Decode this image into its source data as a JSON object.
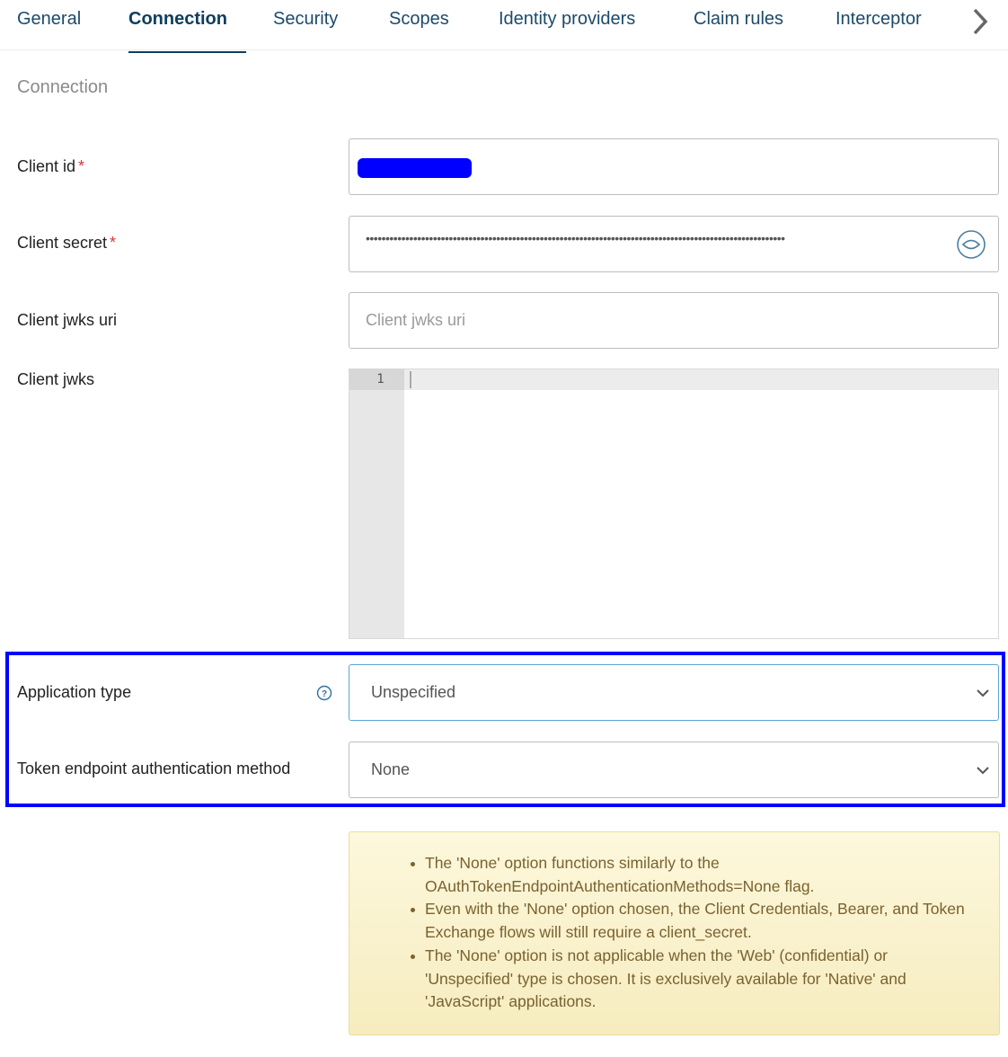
{
  "tabs": [
    {
      "label": "General",
      "active": false
    },
    {
      "label": "Connection",
      "active": true
    },
    {
      "label": "Security",
      "active": false
    },
    {
      "label": "Scopes",
      "active": false
    },
    {
      "label": "Identity providers",
      "active": false
    },
    {
      "label": "Claim rules",
      "active": false
    },
    {
      "label": "Interceptor",
      "active": false
    }
  ],
  "section_title": "Connection",
  "fields": {
    "client_id": {
      "label": "Client id",
      "required_mark": "*",
      "value": "[redacted]"
    },
    "client_secret": {
      "label": "Client secret",
      "required_mark": "*",
      "value": "••••••••••••••••••••••••••••••••••••••••••••••••••••••••••••••••••••••••••••••••••••••••••••••••••••••••••"
    },
    "client_jwks_uri": {
      "label": "Client jwks uri",
      "placeholder": "Client jwks uri",
      "value": ""
    },
    "client_jwks": {
      "label": "Client jwks",
      "line_number": "1",
      "value": ""
    },
    "application_type": {
      "label": "Application type",
      "value": "Unspecified"
    },
    "token_endpoint_auth_method": {
      "label": "Token endpoint authentication method",
      "value": "None"
    }
  },
  "alert": {
    "items": [
      "The 'None' option functions similarly to the OAuthTokenEndpointAuthenticationMethods=None flag.",
      "Even with the 'None' option chosen, the Client Credentials, Bearer, and Token Exchange flows will still require a client_secret.",
      "The 'None' option is not applicable when the 'Web' (confidential) or 'Unspecified' type is chosen. It is exclusively available for 'Native' and 'JavaScript' applications."
    ]
  },
  "colors": {
    "accent": "#0e3e5e",
    "required": "#d23a3a",
    "highlight": "#0000ff",
    "alert_text": "#7a6230"
  }
}
